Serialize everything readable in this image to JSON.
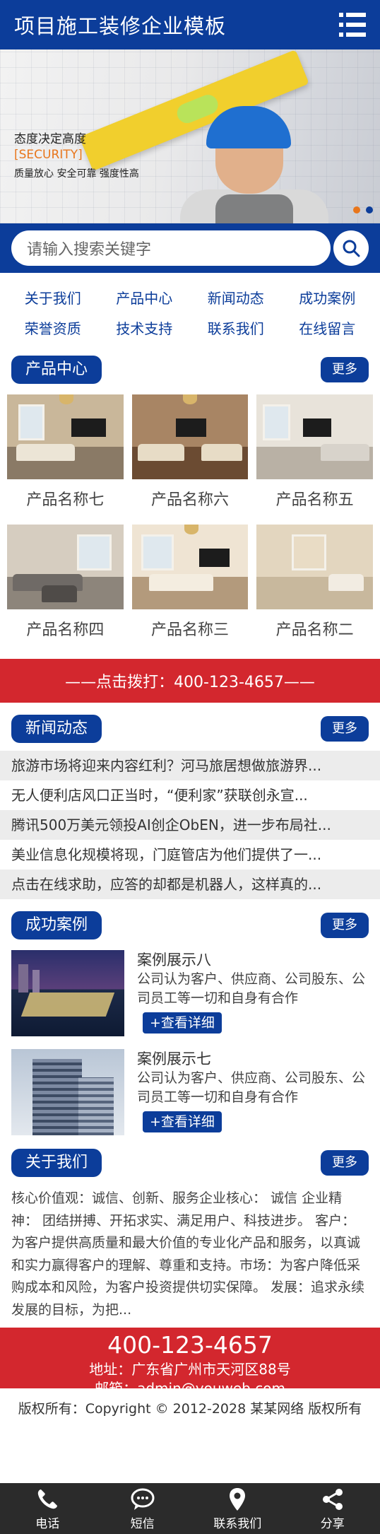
{
  "header": {
    "title": "项目施工装修企业模板",
    "menu_icon": "menu-icon"
  },
  "banner": {
    "slogan_1": "态度决定高度",
    "slogan_2": "[SECURITY]",
    "slogan_3": "质量放心 安全可靠 强度性高",
    "slide_count": 2,
    "active_slide": 2
  },
  "search": {
    "placeholder": "请输入搜索关键字",
    "icon": "search-icon"
  },
  "quicknav": [
    "关于我们",
    "产品中心",
    "新闻动态",
    "成功案例",
    "荣誉资质",
    "技术支持",
    "联系我们",
    "在线留言"
  ],
  "products": {
    "heading": "产品中心",
    "more": "更多",
    "items": [
      "产品名称七",
      "产品名称六",
      "产品名称五",
      "产品名称四",
      "产品名称三",
      "产品名称二"
    ]
  },
  "callbar": {
    "text": "——点击拨打：400-123-4657——"
  },
  "news": {
    "heading": "新闻动态",
    "more": "更多",
    "items": [
      "旅游市场将迎来内容红利？河马旅居想做旅游界...",
      "无人便利店风口正当时，“便利家”获联创永宣...",
      "腾讯500万美元领投AI创企ObEN，进一步布局社...",
      "美业信息化规模将现，门庭管店为他们提供了一...",
      "点击在线求助，应答的却都是机器人，这样真的..."
    ]
  },
  "cases": {
    "heading": "成功案例",
    "more": "更多",
    "items": [
      {
        "title": "案例展示八",
        "desc": "公司认为客户、供应商、公司股东、公司员工等一切和自身有合作",
        "detail": "+查看详细"
      },
      {
        "title": "案例展示七",
        "desc": "公司认为客户、供应商、公司股东、公司员工等一切和自身有合作",
        "detail": "+查看详细"
      }
    ]
  },
  "about": {
    "heading": "关于我们",
    "more": "更多",
    "text": "核心价值观：诚信、创新、服务企业核心： 诚信 企业精神： 团结拼搏、开拓求实、满足用户、科技进步。 客户：为客户提供高质量和最大价值的专业化产品和服务，以真诚和实力赢得客户的理解、尊重和支持。市场：为客户降低采购成本和风险，为客户投资提供切实保障。 发展：追求永续发展的目标，为把..."
  },
  "contact": {
    "phone": "400-123-4657",
    "address": "地址：广东省广州市天河区88号",
    "email": "邮箱：admin@youweb.com"
  },
  "footer": {
    "copyright": "版权所有：Copyright © 2012-2028 某某网络 版权所有"
  },
  "bottom_bar": [
    {
      "label": "电话",
      "icon": "phone-icon"
    },
    {
      "label": "短信",
      "icon": "message-icon"
    },
    {
      "label": "联系我们",
      "icon": "location-icon"
    },
    {
      "label": "分享",
      "icon": "share-icon"
    }
  ],
  "colors": {
    "primary": "#0c3d9a",
    "accent": "#d3272e",
    "bar": "#2b2b2b"
  }
}
